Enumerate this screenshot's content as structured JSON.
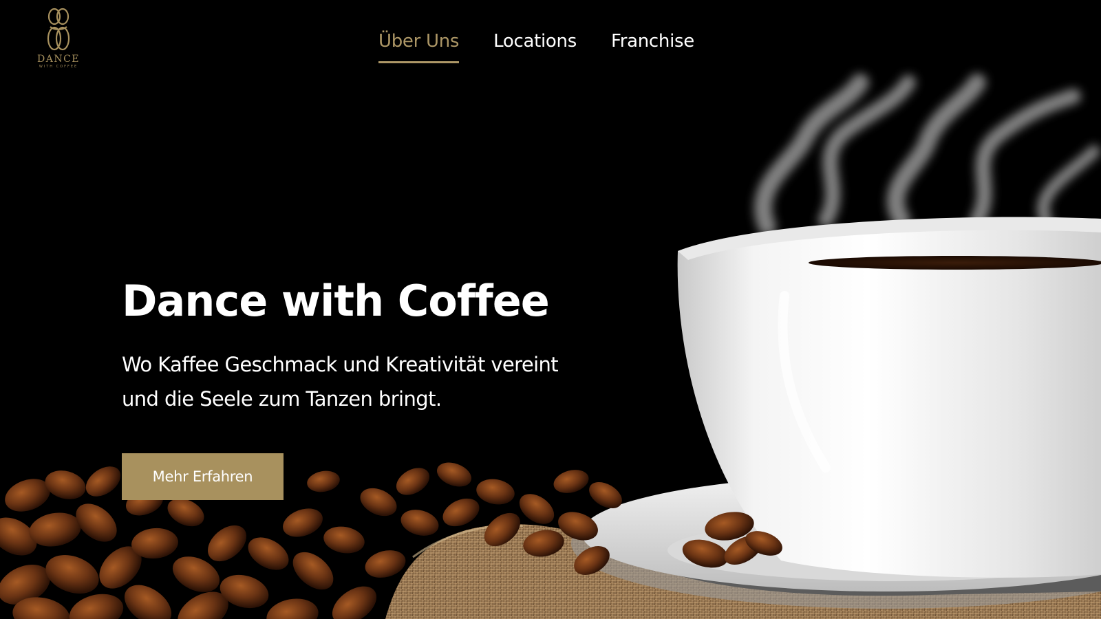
{
  "brand": {
    "name": "DANCE",
    "tagline": "WITH COFFEE"
  },
  "nav": {
    "items": [
      {
        "label": "Über Uns",
        "active": true
      },
      {
        "label": "Locations",
        "active": false
      },
      {
        "label": "Franchise",
        "active": false
      }
    ]
  },
  "hero": {
    "title": "Dance with Coffee",
    "subtitle": "Wo Kaffee Geschmack und Kreativität vereint und die Seele zum Tanzen bringt.",
    "cta_label": "Mehr Erfahren"
  },
  "colors": {
    "background": "#000000",
    "accent_gold": "#a8915e",
    "text": "#ffffff"
  }
}
